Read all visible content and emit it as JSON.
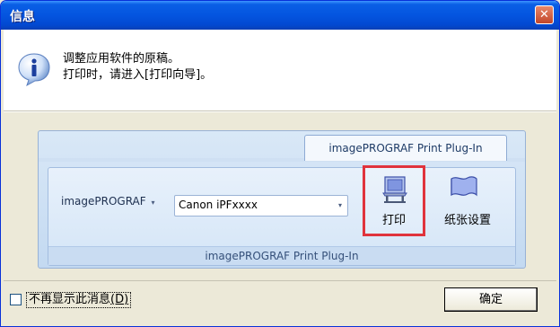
{
  "window": {
    "title": "信息",
    "close_glyph": "✕"
  },
  "message": {
    "line1": "调整应用软件的原稿。",
    "line2": "打印时，请进入[打印向导]。",
    "icon": "info-icon"
  },
  "plugin": {
    "tab_label": "imagePROGRAF Print Plug-In",
    "printer_label": "imagePROGRAF",
    "printer_caret": "▾",
    "printer_value": "Canon iPFxxxx",
    "combo_arrow": "▾",
    "print_label": "打印",
    "paper_label": "纸张设置",
    "group_caption": "imagePROGRAF Print Plug-In",
    "print_icon": "printer-icon",
    "paper_icon": "paper-roll-icon"
  },
  "footer": {
    "checkbox_label": "不再显示此消息",
    "checkbox_shortcut": "(D)",
    "checkbox_checked": false,
    "ok_label": "确定"
  },
  "colors": {
    "titlebar": "#0455e0",
    "highlight_border": "#e0333c",
    "panel_blue": "#c3d9f1"
  }
}
